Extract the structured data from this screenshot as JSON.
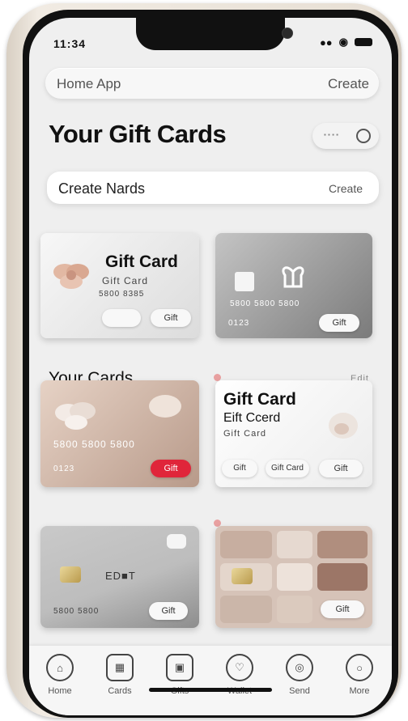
{
  "status_bar": {
    "time": "11:34",
    "signal": "●●",
    "wifi": "◉"
  },
  "topbar": {
    "app_name": "Home App",
    "create_label": "Create"
  },
  "page": {
    "title": "Your Gift Cards",
    "pill_text": "▪ ▪ ▪ ▪"
  },
  "create_bar": {
    "label": "Create Nards",
    "action": "Create"
  },
  "cards_top": [
    {
      "title": "Gift Card",
      "subtitle": "Gift Card",
      "number": "5800 8385",
      "button": "Gift"
    },
    {
      "number": "5800 5800 5800",
      "expiry": "0123",
      "button": "Gift"
    }
  ],
  "section": {
    "title": "Your Cards",
    "right": "Edit"
  },
  "cards_mid": [
    {
      "number": "5800 5800 5800",
      "expiry": "0123",
      "button": "Gift"
    },
    {
      "title": "Gift Card",
      "subtitle": "Eift Ccerd",
      "detail": "Gift Card",
      "tag1": "Gift",
      "tag2": "Gift Card",
      "button": "Gift"
    }
  ],
  "cards_bottom": [
    {
      "name": "ED■T",
      "number": "5800 5800",
      "button": "Gift"
    },
    {
      "button": "Gift"
    }
  ],
  "nav": [
    {
      "label": "Home",
      "icon": "home-icon"
    },
    {
      "label": "Cards",
      "icon": "cards-icon"
    },
    {
      "label": "Gifts",
      "icon": "gift-icon"
    },
    {
      "label": "Wallet",
      "icon": "wallet-icon"
    },
    {
      "label": "Send",
      "icon": "send-icon"
    },
    {
      "label": "More",
      "icon": "more-icon"
    }
  ],
  "colors": {
    "screen_bg": "#efefef",
    "accent_red": "#e0253a",
    "text_dark": "#111111"
  }
}
